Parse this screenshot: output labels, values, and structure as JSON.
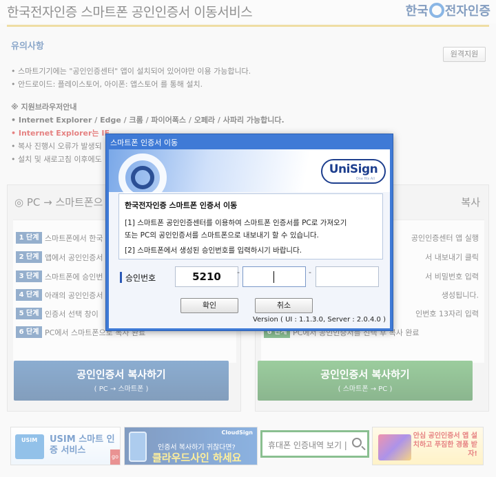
{
  "header": {
    "title": "한국전자인증 스마트폰 공인인증서 이동서비스",
    "logo_left": "한국",
    "logo_right": "전자인증"
  },
  "notice": {
    "title": "유의사항",
    "remote_label": "원격지원",
    "lines": [
      "• 스마트기기에는 \"공인인증센터\" 앱이 설치되어 있어야만 이용 가능합니다.",
      "• 안드로이드: 플레이스토어, 아이폰: 앱스토어 를 통해 설치.",
      "※ 지원브라우저안내",
      "• Internet Explorer / Edge / 크롬 / 파이어폭스 / 오페라 / 사파리 가능합니다.",
      "• Internet Explorer는 IE",
      "• 복사 진행시 오류가 발생되",
      "• 설치 및 새로고침 이후에도"
    ]
  },
  "left_panel": {
    "title": "◎ PC → 스마트폰으",
    "steps": [
      {
        "badge": "1 단계",
        "text": "스마트폰에서 한국"
      },
      {
        "badge": "2 단계",
        "text": "앱에서 공인인증서"
      },
      {
        "badge": "3 단계",
        "text": "스마트폰에 승인번"
      },
      {
        "badge": "4 단계",
        "text": "아래의 공인인증서"
      },
      {
        "badge": "5 단계",
        "text": "인증서 선택 창이"
      },
      {
        "badge": "6 단계",
        "text": "PC에서 스마트폰으로 복사 완료"
      }
    ],
    "button_label": "공인인증서 복사하기",
    "button_sub": "( PC → 스마트폰 )"
  },
  "right_panel": {
    "title": "복사",
    "steps": [
      {
        "text": "공인인증센터 앱 실행"
      },
      {
        "text": "서 내보내기 클릭"
      },
      {
        "text": "서 비밀번호 입력"
      },
      {
        "text": "생성됩니다."
      },
      {
        "text": "인번호 13자리 입력"
      },
      {
        "badge": "6 단계",
        "text": "PC에서 공인인증서를 선택 후 복사 완료"
      }
    ],
    "button_label": "공인인증서 복사하기",
    "button_sub": "( 스마트폰 → PC )"
  },
  "footer": {
    "usim_card": "USIM",
    "usim_title": "USIM 스마트 인증 서비스",
    "usim_go": "go",
    "cloud_brand": "CloudSign",
    "cloud_line1": "인증서 복사하기 귀찮다면?",
    "cloud_line2": "클라우드사인 하세요",
    "search_label": "휴대폰 인증내역 보기 |",
    "promo": "안심 공인인증서 앱 설치하고 푸짐한 경품 받자!"
  },
  "dialog": {
    "title": "스마트폰 인증서 이동",
    "brand": "UniSign",
    "brand_tag": "One fits All",
    "msg_title": "한국전자인증 스마트폰 인증서 이동",
    "msg_line1": "[1] 스마트폰 공인인증센터를 이용하여 스마트폰 인증서를 PC로 가져오기",
    "msg_line2": "또는 PC의 공인인증서를 스마트폰으로 내보내기 할 수 있습니다.",
    "msg_line3": "[2] 스마트폰에서 생성된 승인번호를 입력하시기 바랍니다.",
    "auth_label": "승인번호",
    "auth_values": [
      "5210",
      "",
      ""
    ],
    "dash": "-",
    "ok_label": "확인",
    "cancel_label": "취소",
    "version": "Version ( UI : 1.1.3.0, Server : 2.0.4.0 )"
  }
}
